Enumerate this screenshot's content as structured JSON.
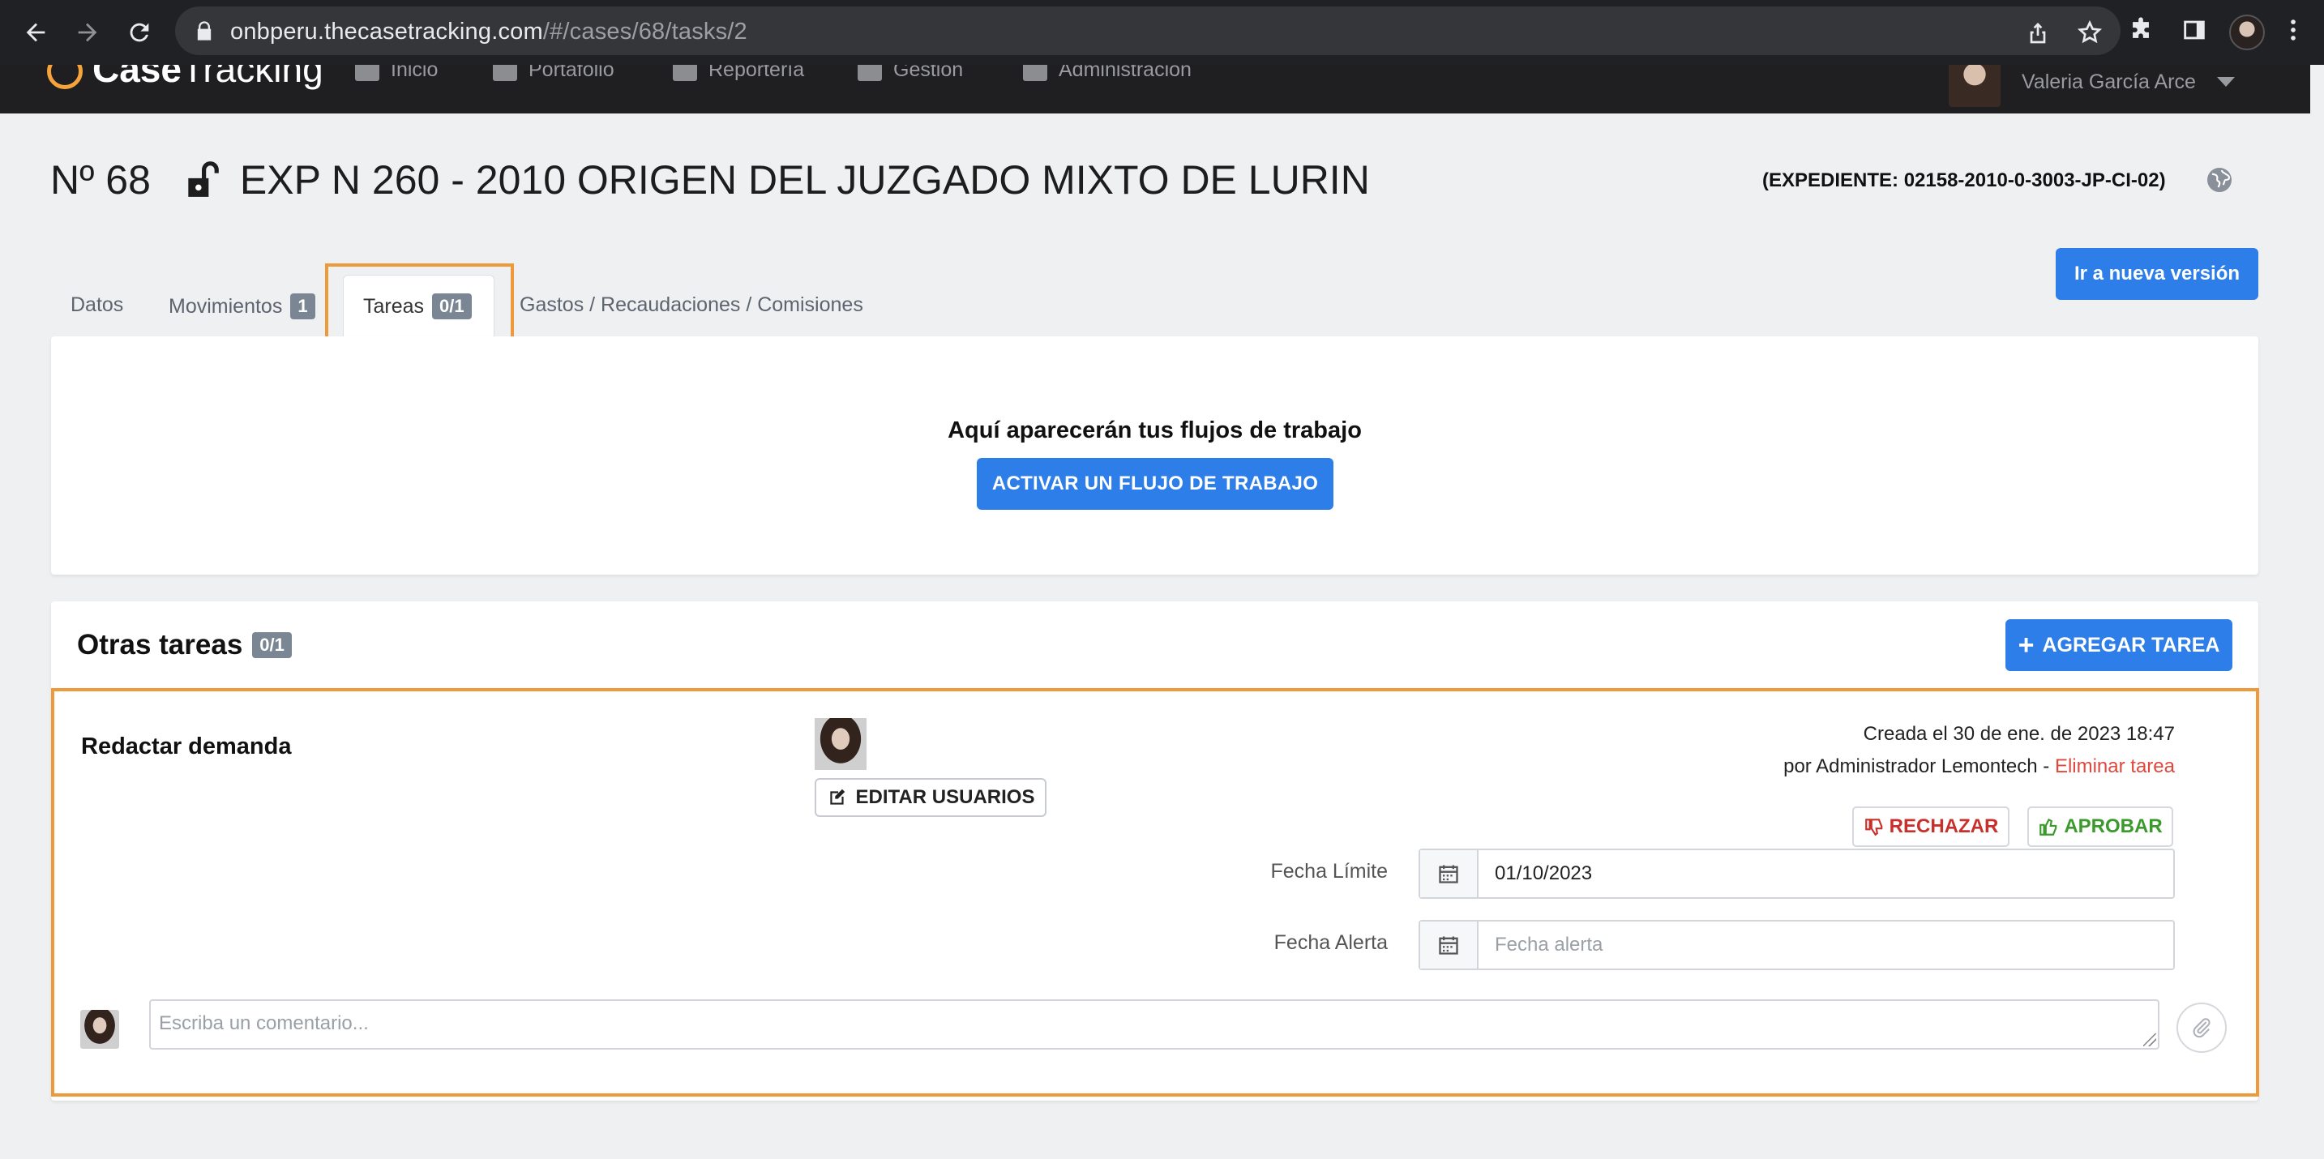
{
  "browser": {
    "url_host": "onbperu.thecasetracking.com",
    "url_path": "/#/cases/68/tasks/2"
  },
  "app": {
    "logo_bold": "Case",
    "logo_light": "Tracking",
    "menu": [
      "Inicio",
      "Portafolio",
      "Reportería",
      "Gestión",
      "Administración"
    ],
    "user_name": "Valeria García Arce"
  },
  "case": {
    "number": "Nº 68",
    "title": "EXP N 260 - 2010 ORIGEN DEL JUZGADO MIXTO DE LURIN",
    "expediente": "(EXPEDIENTE: 02158-2010-0-3003-JP-CI-02)",
    "new_version_button": "Ir a nueva versión"
  },
  "tabs": [
    {
      "label": "Datos",
      "badge": ""
    },
    {
      "label": "Movimientos",
      "badge": "1"
    },
    {
      "label": "Tareas",
      "badge": "0/1",
      "active": true
    },
    {
      "label": "Gastos / Recaudaciones / Comisiones",
      "badge": ""
    }
  ],
  "workflow": {
    "heading": "Aquí aparecerán tus flujos de trabajo",
    "button": "ACTIVAR UN FLUJO DE TRABAJO"
  },
  "other_tasks": {
    "title": "Otras tareas",
    "badge": "0/1",
    "add_button": "AGREGAR TAREA",
    "task": {
      "name": "Redactar demanda",
      "edit_users_button": "EDITAR USUARIOS",
      "created": "Creada el 30 de ene. de 2023 18:47",
      "created_by": "por Administrador Lemontech -",
      "delete_link": "Eliminar tarea",
      "reject_button": "RECHAZAR",
      "approve_button": "APROBAR",
      "due_label": "Fecha Límite",
      "due_value": "01/10/2023",
      "alert_label": "Fecha Alerta",
      "alert_placeholder": "Fecha alerta",
      "comment_placeholder": "Escriba un comentario..."
    }
  },
  "colors": {
    "accent_blue": "#2d7ee8",
    "highlight_orange": "#ef9a3a",
    "danger_red": "#c9302c",
    "success_green": "#3a9a2b"
  }
}
